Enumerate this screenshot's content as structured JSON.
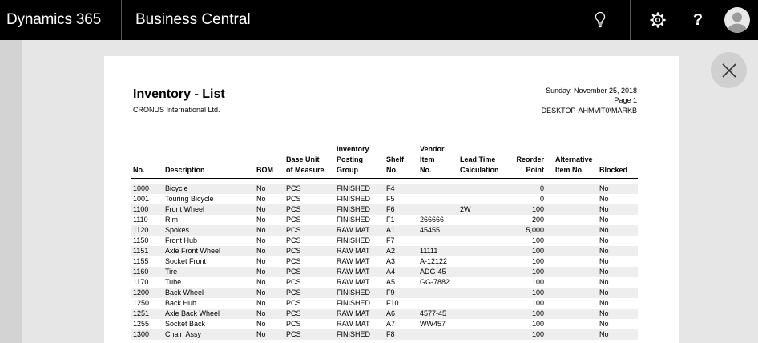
{
  "topbar": {
    "brand": "Dynamics 365",
    "app": "Business Central",
    "icons": [
      "lightbulb-icon",
      "gear-icon",
      "help-icon",
      "avatar-icon"
    ],
    "help_label": "?"
  },
  "report": {
    "title": "Inventory - List",
    "company": "CRONUS International Ltd.",
    "date": "Sunday, November 25, 2018",
    "page": "Page 1",
    "user": "DESKTOP-AHMVIT0\\MARKB",
    "columns": {
      "no": "No.",
      "description": "Description",
      "bom": "BOM",
      "base_unit_1": "Base Unit",
      "base_unit_2": "of Measure",
      "posting_1": "Inventory",
      "posting_2": "Posting",
      "posting_3": "Group",
      "shelf_1": "Shelf",
      "shelf_2": "No.",
      "vendor_1": "Vendor",
      "vendor_2": "Item",
      "vendor_3": "No.",
      "lead_1": "Lead Time",
      "lead_2": "Calculation",
      "reorder_1": "Reorder",
      "reorder_2": "Point",
      "alt_1": "Alternative",
      "alt_2": "Item No.",
      "blocked": "Blocked"
    },
    "rows": [
      {
        "no": "1000",
        "description": "Bicycle",
        "bom": "No",
        "uom": "PCS",
        "posting": "FINISHED",
        "shelf": "F4",
        "vendor_item": "",
        "lead_time": "",
        "reorder": "0",
        "alt": "",
        "blocked": "No"
      },
      {
        "no": "1001",
        "description": "Touring Bicycle",
        "bom": "No",
        "uom": "PCS",
        "posting": "FINISHED",
        "shelf": "F5",
        "vendor_item": "",
        "lead_time": "",
        "reorder": "0",
        "alt": "",
        "blocked": "No"
      },
      {
        "no": "1100",
        "description": "Front Wheel",
        "bom": "No",
        "uom": "PCS",
        "posting": "FINISHED",
        "shelf": "F6",
        "vendor_item": "",
        "lead_time": "2W",
        "reorder": "100",
        "alt": "",
        "blocked": "No"
      },
      {
        "no": "1110",
        "description": "Rim",
        "bom": "No",
        "uom": "PCS",
        "posting": "FINISHED",
        "shelf": "F1",
        "vendor_item": "266666",
        "lead_time": "",
        "reorder": "200",
        "alt": "",
        "blocked": "No"
      },
      {
        "no": "1120",
        "description": "Spokes",
        "bom": "No",
        "uom": "PCS",
        "posting": "RAW MAT",
        "shelf": "A1",
        "vendor_item": "45455",
        "lead_time": "",
        "reorder": "5,000",
        "alt": "",
        "blocked": "No"
      },
      {
        "no": "1150",
        "description": "Front Hub",
        "bom": "No",
        "uom": "PCS",
        "posting": "FINISHED",
        "shelf": "F7",
        "vendor_item": "",
        "lead_time": "",
        "reorder": "100",
        "alt": "",
        "blocked": "No"
      },
      {
        "no": "1151",
        "description": "Axle Front Wheel",
        "bom": "No",
        "uom": "PCS",
        "posting": "RAW MAT",
        "shelf": "A2",
        "vendor_item": "11111",
        "lead_time": "",
        "reorder": "100",
        "alt": "",
        "blocked": "No"
      },
      {
        "no": "1155",
        "description": "Socket Front",
        "bom": "No",
        "uom": "PCS",
        "posting": "RAW MAT",
        "shelf": "A3",
        "vendor_item": "A-12122",
        "lead_time": "",
        "reorder": "100",
        "alt": "",
        "blocked": "No"
      },
      {
        "no": "1160",
        "description": "Tire",
        "bom": "No",
        "uom": "PCS",
        "posting": "RAW MAT",
        "shelf": "A4",
        "vendor_item": "ADG-45",
        "lead_time": "",
        "reorder": "100",
        "alt": "",
        "blocked": "No"
      },
      {
        "no": "1170",
        "description": "Tube",
        "bom": "No",
        "uom": "PCS",
        "posting": "RAW MAT",
        "shelf": "A5",
        "vendor_item": "GG-7882",
        "lead_time": "",
        "reorder": "100",
        "alt": "",
        "blocked": "No"
      },
      {
        "no": "1200",
        "description": "Back Wheel",
        "bom": "No",
        "uom": "PCS",
        "posting": "FINISHED",
        "shelf": "F9",
        "vendor_item": "",
        "lead_time": "",
        "reorder": "100",
        "alt": "",
        "blocked": "No"
      },
      {
        "no": "1250",
        "description": "Back Hub",
        "bom": "No",
        "uom": "PCS",
        "posting": "FINISHED",
        "shelf": "F10",
        "vendor_item": "",
        "lead_time": "",
        "reorder": "100",
        "alt": "",
        "blocked": "No"
      },
      {
        "no": "1251",
        "description": "Axle Back Wheel",
        "bom": "No",
        "uom": "PCS",
        "posting": "RAW MAT",
        "shelf": "A6",
        "vendor_item": "4577-45",
        "lead_time": "",
        "reorder": "100",
        "alt": "",
        "blocked": "No"
      },
      {
        "no": "1255",
        "description": "Socket Back",
        "bom": "No",
        "uom": "PCS",
        "posting": "RAW MAT",
        "shelf": "A7",
        "vendor_item": "WW457",
        "lead_time": "",
        "reorder": "100",
        "alt": "",
        "blocked": "No"
      },
      {
        "no": "1300",
        "description": "Chain Assy",
        "bom": "No",
        "uom": "PCS",
        "posting": "FINISHED",
        "shelf": "F8",
        "vendor_item": "",
        "lead_time": "",
        "reorder": "100",
        "alt": "",
        "blocked": "No"
      }
    ]
  },
  "colors": {
    "topbar": "#000000",
    "background": "#e6e6e6",
    "row_shade": "#eeeeee",
    "close_button": "#d0d0d0"
  }
}
